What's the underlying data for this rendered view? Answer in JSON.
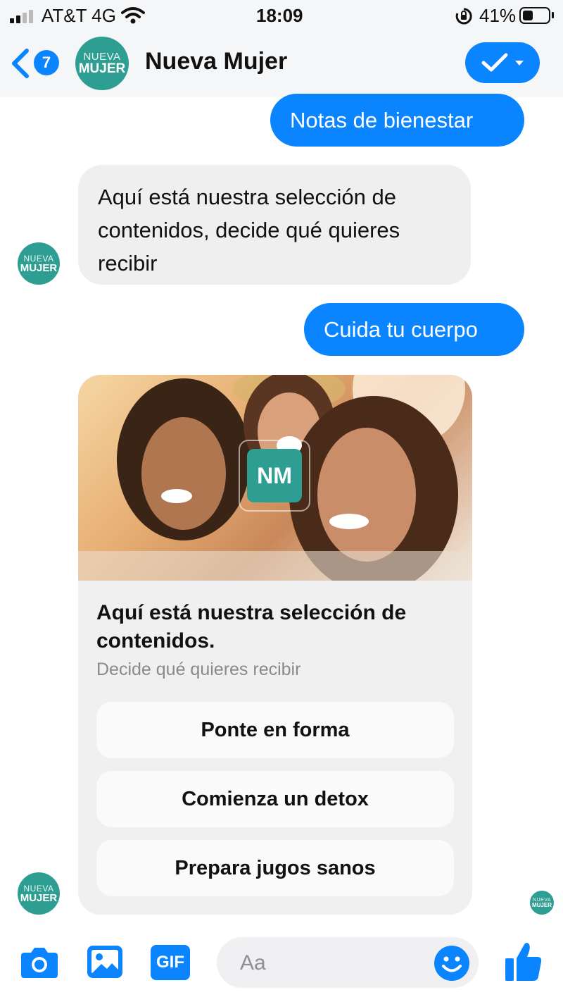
{
  "status_bar": {
    "carrier": "AT&T 4G",
    "time": "18:09",
    "battery_percent": "41%",
    "battery_level": 0.41
  },
  "header": {
    "back_count": "7",
    "chat_title": "Nueva Mujer",
    "avatar_line1": "NUEVA",
    "avatar_line2": "MUJER"
  },
  "messages": [
    {
      "from": "user",
      "text": "Notas de bienestar"
    },
    {
      "from": "bot",
      "text": "Aquí está nuestra selección de contenidos, decide qué quieres recibir"
    },
    {
      "from": "user",
      "text": "Cuida tu cuerpo"
    }
  ],
  "card": {
    "logo_text": "NM",
    "title": "Aquí está nuestra selección de contenidos.",
    "subtitle": "Decide qué quieres recibir",
    "buttons": [
      "Ponte en forma",
      "Comienza un detox",
      "Prepara jugos sanos"
    ]
  },
  "composer": {
    "placeholder": "Aa",
    "gif_label": "GIF"
  },
  "icons": {
    "signal": "signal-icon",
    "wifi": "wifi-icon",
    "lock_rotation": "orientation-lock-icon",
    "battery": "battery-icon",
    "back": "chevron-left-icon",
    "check": "check-icon",
    "camera": "camera-icon",
    "image": "image-icon",
    "gif": "gif-icon",
    "emoji": "smiley-icon",
    "like": "thumbs-up-icon"
  },
  "colors": {
    "accent": "#0a84ff",
    "brand_teal": "#2f9e92",
    "bubble_in": "#efeff0"
  }
}
